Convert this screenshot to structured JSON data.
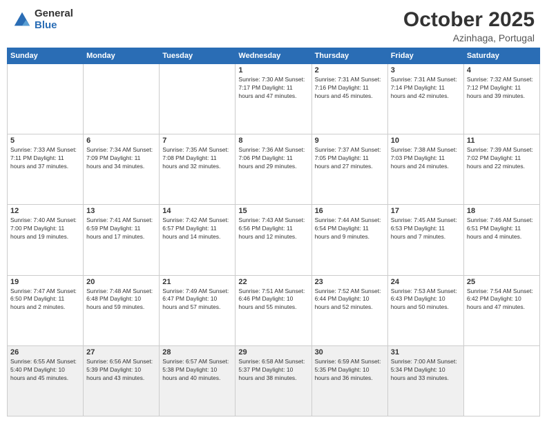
{
  "header": {
    "logo_general": "General",
    "logo_blue": "Blue",
    "month": "October 2025",
    "location": "Azinhaga, Portugal"
  },
  "weekdays": [
    "Sunday",
    "Monday",
    "Tuesday",
    "Wednesday",
    "Thursday",
    "Friday",
    "Saturday"
  ],
  "weeks": [
    [
      {
        "day": "",
        "info": ""
      },
      {
        "day": "",
        "info": ""
      },
      {
        "day": "",
        "info": ""
      },
      {
        "day": "1",
        "info": "Sunrise: 7:30 AM\nSunset: 7:17 PM\nDaylight: 11 hours\nand 47 minutes."
      },
      {
        "day": "2",
        "info": "Sunrise: 7:31 AM\nSunset: 7:16 PM\nDaylight: 11 hours\nand 45 minutes."
      },
      {
        "day": "3",
        "info": "Sunrise: 7:31 AM\nSunset: 7:14 PM\nDaylight: 11 hours\nand 42 minutes."
      },
      {
        "day": "4",
        "info": "Sunrise: 7:32 AM\nSunset: 7:12 PM\nDaylight: 11 hours\nand 39 minutes."
      }
    ],
    [
      {
        "day": "5",
        "info": "Sunrise: 7:33 AM\nSunset: 7:11 PM\nDaylight: 11 hours\nand 37 minutes."
      },
      {
        "day": "6",
        "info": "Sunrise: 7:34 AM\nSunset: 7:09 PM\nDaylight: 11 hours\nand 34 minutes."
      },
      {
        "day": "7",
        "info": "Sunrise: 7:35 AM\nSunset: 7:08 PM\nDaylight: 11 hours\nand 32 minutes."
      },
      {
        "day": "8",
        "info": "Sunrise: 7:36 AM\nSunset: 7:06 PM\nDaylight: 11 hours\nand 29 minutes."
      },
      {
        "day": "9",
        "info": "Sunrise: 7:37 AM\nSunset: 7:05 PM\nDaylight: 11 hours\nand 27 minutes."
      },
      {
        "day": "10",
        "info": "Sunrise: 7:38 AM\nSunset: 7:03 PM\nDaylight: 11 hours\nand 24 minutes."
      },
      {
        "day": "11",
        "info": "Sunrise: 7:39 AM\nSunset: 7:02 PM\nDaylight: 11 hours\nand 22 minutes."
      }
    ],
    [
      {
        "day": "12",
        "info": "Sunrise: 7:40 AM\nSunset: 7:00 PM\nDaylight: 11 hours\nand 19 minutes."
      },
      {
        "day": "13",
        "info": "Sunrise: 7:41 AM\nSunset: 6:59 PM\nDaylight: 11 hours\nand 17 minutes."
      },
      {
        "day": "14",
        "info": "Sunrise: 7:42 AM\nSunset: 6:57 PM\nDaylight: 11 hours\nand 14 minutes."
      },
      {
        "day": "15",
        "info": "Sunrise: 7:43 AM\nSunset: 6:56 PM\nDaylight: 11 hours\nand 12 minutes."
      },
      {
        "day": "16",
        "info": "Sunrise: 7:44 AM\nSunset: 6:54 PM\nDaylight: 11 hours\nand 9 minutes."
      },
      {
        "day": "17",
        "info": "Sunrise: 7:45 AM\nSunset: 6:53 PM\nDaylight: 11 hours\nand 7 minutes."
      },
      {
        "day": "18",
        "info": "Sunrise: 7:46 AM\nSunset: 6:51 PM\nDaylight: 11 hours\nand 4 minutes."
      }
    ],
    [
      {
        "day": "19",
        "info": "Sunrise: 7:47 AM\nSunset: 6:50 PM\nDaylight: 11 hours\nand 2 minutes."
      },
      {
        "day": "20",
        "info": "Sunrise: 7:48 AM\nSunset: 6:48 PM\nDaylight: 10 hours\nand 59 minutes."
      },
      {
        "day": "21",
        "info": "Sunrise: 7:49 AM\nSunset: 6:47 PM\nDaylight: 10 hours\nand 57 minutes."
      },
      {
        "day": "22",
        "info": "Sunrise: 7:51 AM\nSunset: 6:46 PM\nDaylight: 10 hours\nand 55 minutes."
      },
      {
        "day": "23",
        "info": "Sunrise: 7:52 AM\nSunset: 6:44 PM\nDaylight: 10 hours\nand 52 minutes."
      },
      {
        "day": "24",
        "info": "Sunrise: 7:53 AM\nSunset: 6:43 PM\nDaylight: 10 hours\nand 50 minutes."
      },
      {
        "day": "25",
        "info": "Sunrise: 7:54 AM\nSunset: 6:42 PM\nDaylight: 10 hours\nand 47 minutes."
      }
    ],
    [
      {
        "day": "26",
        "info": "Sunrise: 6:55 AM\nSunset: 5:40 PM\nDaylight: 10 hours\nand 45 minutes."
      },
      {
        "day": "27",
        "info": "Sunrise: 6:56 AM\nSunset: 5:39 PM\nDaylight: 10 hours\nand 43 minutes."
      },
      {
        "day": "28",
        "info": "Sunrise: 6:57 AM\nSunset: 5:38 PM\nDaylight: 10 hours\nand 40 minutes."
      },
      {
        "day": "29",
        "info": "Sunrise: 6:58 AM\nSunset: 5:37 PM\nDaylight: 10 hours\nand 38 minutes."
      },
      {
        "day": "30",
        "info": "Sunrise: 6:59 AM\nSunset: 5:35 PM\nDaylight: 10 hours\nand 36 minutes."
      },
      {
        "day": "31",
        "info": "Sunrise: 7:00 AM\nSunset: 5:34 PM\nDaylight: 10 hours\nand 33 minutes."
      },
      {
        "day": "",
        "info": ""
      }
    ]
  ]
}
